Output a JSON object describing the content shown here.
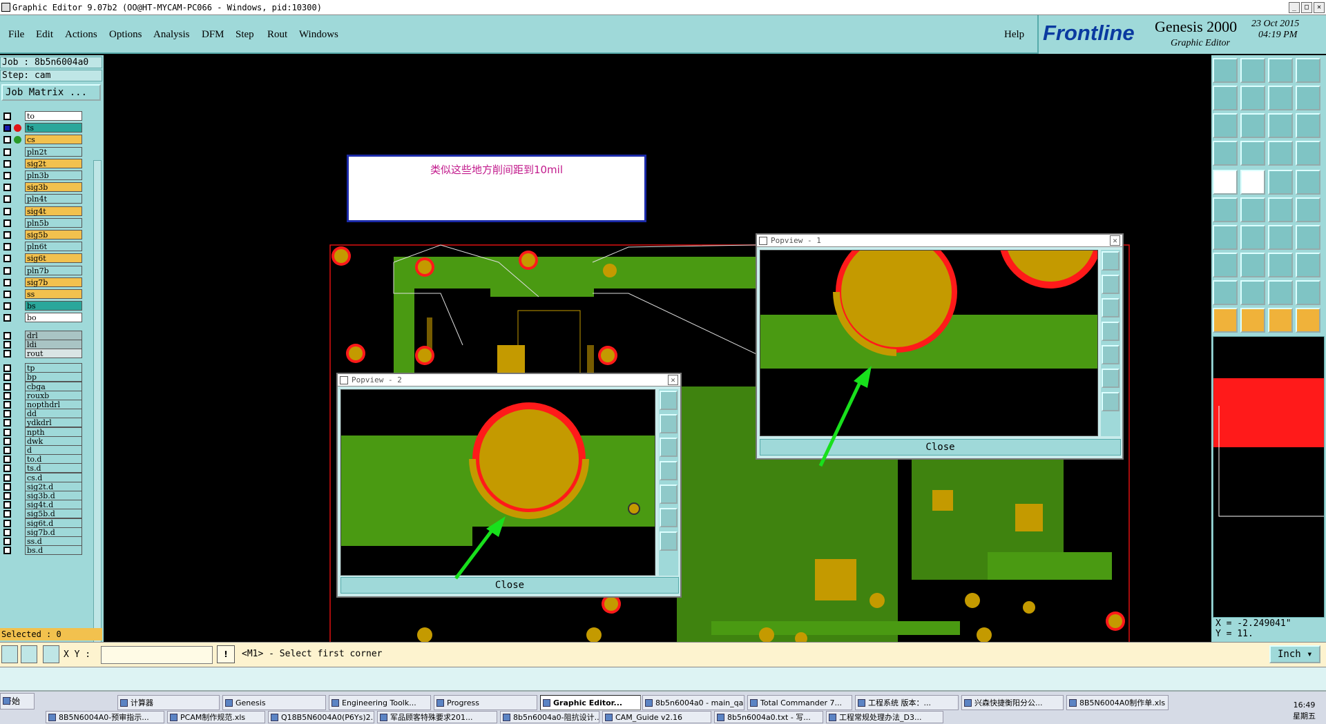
{
  "window": {
    "title": "Graphic Editor 9.07b2 (OO@HT-MYCAM-PC066 - Windows, pid:10300)",
    "controls": [
      "_",
      "□",
      "✕"
    ]
  },
  "menu": [
    "File",
    "Edit",
    "Actions",
    "Options",
    "Analysis",
    "DFM",
    "Step",
    "Rout",
    "Windows"
  ],
  "help": "Help",
  "brand": {
    "logo": "Frontline",
    "product": "Genesis 2000",
    "subtitle": "Graphic Editor",
    "date": "23 Oct 2015",
    "time": "04:19 PM"
  },
  "job": {
    "job_line": "Job : 8b5n6004a0",
    "step_line": "Step: cam",
    "matrix_button": "Job Matrix ..."
  },
  "layers": [
    {
      "name": "to",
      "color": "#ffffff"
    },
    {
      "name": "ts",
      "color": "#2aa79b",
      "active": true
    },
    {
      "name": "cs",
      "color": "#f2c14e",
      "display": true
    },
    {
      "name": "pln2t",
      "color": "#9fd9d9"
    },
    {
      "name": "sig2t",
      "color": "#f2c14e"
    },
    {
      "name": "pln3b",
      "color": "#9fd9d9"
    },
    {
      "name": "sig3b",
      "color": "#f2c14e"
    },
    {
      "name": "pln4t",
      "color": "#9fd9d9"
    },
    {
      "name": "sig4t",
      "color": "#f2c14e"
    },
    {
      "name": "pln5b",
      "color": "#9fd9d9"
    },
    {
      "name": "sig5b",
      "color": "#f2c14e"
    },
    {
      "name": "pln6t",
      "color": "#9fd9d9"
    },
    {
      "name": "sig6t",
      "color": "#f2c14e"
    },
    {
      "name": "pln7b",
      "color": "#9fd9d9"
    },
    {
      "name": "sig7b",
      "color": "#f2c14e"
    },
    {
      "name": "ss",
      "color": "#f2c14e"
    },
    {
      "name": "bs",
      "color": "#2aa79b"
    },
    {
      "name": "bo",
      "color": "#ffffff"
    },
    {
      "name": "drl",
      "color": "#a9c4c4"
    },
    {
      "name": "ldi",
      "color": "#a9c4c4"
    },
    {
      "name": "rout",
      "color": "#d9e4e4"
    },
    {
      "name": "tp",
      "color": "#9fd9d9"
    },
    {
      "name": "bp",
      "color": "#9fd9d9"
    },
    {
      "name": "cbga",
      "color": "#9fd9d9"
    },
    {
      "name": "rouxb",
      "color": "#9fd9d9"
    },
    {
      "name": "nopthdrl",
      "color": "#9fd9d9"
    },
    {
      "name": "dd",
      "color": "#9fd9d9"
    },
    {
      "name": "ydkdrl",
      "color": "#9fd9d9"
    },
    {
      "name": "npth",
      "color": "#9fd9d9"
    },
    {
      "name": "dwk",
      "color": "#9fd9d9"
    },
    {
      "name": "d",
      "color": "#9fd9d9"
    },
    {
      "name": "to.d",
      "color": "#9fd9d9"
    },
    {
      "name": "ts.d",
      "color": "#9fd9d9"
    },
    {
      "name": "cs.d",
      "color": "#9fd9d9"
    },
    {
      "name": "sig2t.d",
      "color": "#9fd9d9"
    },
    {
      "name": "sig3b.d",
      "color": "#9fd9d9"
    },
    {
      "name": "sig4t.d",
      "color": "#9fd9d9"
    },
    {
      "name": "sig5b.d",
      "color": "#9fd9d9"
    },
    {
      "name": "sig6t.d",
      "color": "#9fd9d9"
    },
    {
      "name": "sig7b.d",
      "color": "#9fd9d9"
    },
    {
      "name": "ss.d",
      "color": "#9fd9d9"
    },
    {
      "name": "bs.d",
      "color": "#9fd9d9"
    }
  ],
  "selected": "Selected : 0",
  "annotation": "类似这些地方削间距到10mil",
  "popviews": [
    {
      "title": "Popview - 1",
      "close": "Close"
    },
    {
      "title": "Popview - 2",
      "close": "Close"
    }
  ],
  "coords": {
    "x": "X = -2.249041\"",
    "y": "Y = 11."
  },
  "command": {
    "xy_label": "X Y :",
    "xy_value": "",
    "prompt": "<M1> - Select first corner",
    "units": "Inch"
  },
  "taskbar": {
    "start": "开始",
    "row1": [
      "计算器",
      "Genesis",
      "Engineering Toolk...",
      "Progress",
      "Graphic Editor...",
      "8b5n6004a0 - main_qa",
      "Total Commander 7...",
      "工程系统   版本：...",
      "兴森快捷衡阳分公...",
      "8B5N6004A0制作单.xls"
    ],
    "row2": [
      "8B5N6004A0-预审指示...",
      "PCAM制作规范.xls",
      "Q18B5N6004A0(P6Ys)2...",
      "军品顾客特殊要求201...",
      "8b5n6004a0-阻抗设计...",
      "CAM_Guide v2.16",
      "8b5n6004a0.txt - 写...",
      "工程常规处理办法_D3..."
    ],
    "active": "Graphic Editor...",
    "time": "16:49",
    "day": "星期五"
  },
  "colors": {
    "panel": "#9fd9d9",
    "copper": "#4a9a12",
    "pad": "#c49a00",
    "mask": "#ff1a1a",
    "arrow": "#18e01c"
  }
}
